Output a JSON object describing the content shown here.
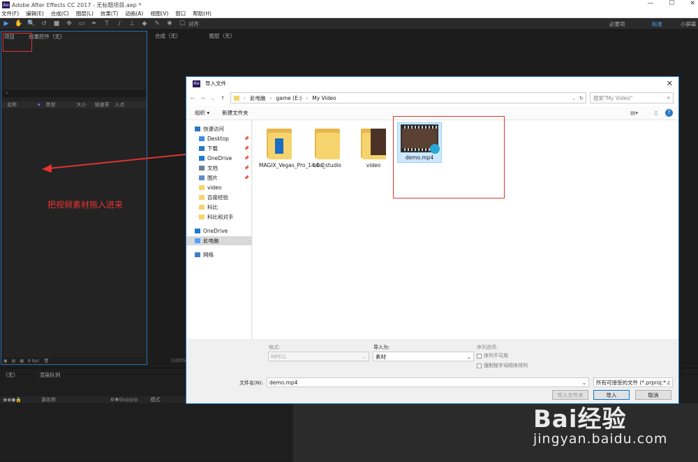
{
  "app": {
    "title": "Adobe After Effects CC 2017 - 无标题项目.aep *",
    "logo": "Ae"
  },
  "menu": [
    "文件(F)",
    "编辑(E)",
    "合成(C)",
    "图层(L)",
    "效果(T)",
    "动画(A)",
    "视图(V)",
    "窗口",
    "帮助(H)"
  ],
  "toolbar": {
    "snap_label": "对齐",
    "workspaces": [
      "必要项",
      "标准",
      "小屏幕"
    ]
  },
  "project_panel": {
    "tab": "项目",
    "effect_tab": "效果控件（无）",
    "columns": [
      "名称",
      "类型",
      "大小",
      "帧速率",
      "入点"
    ],
    "footer": "8 bpc"
  },
  "comp_panel": {
    "tab": "合成（无）",
    "layer_tab": "图层（无）",
    "zoom": "(100%)"
  },
  "timeline": {
    "tab": "（无）",
    "render_tab": "渲染队列",
    "columns": [
      "源名称",
      "模式"
    ]
  },
  "annotation": "把视频素材拖入进来",
  "dialog": {
    "title": "导入文件",
    "path": [
      "此电脑",
      "game (E:)",
      "My Video"
    ],
    "search_placeholder": "搜索\"My Video\"",
    "organize": "组织 ▾",
    "new_folder": "新建文件夹",
    "nav": [
      {
        "label": "快速访问",
        "icon": "star-icon"
      },
      {
        "label": "Desktop",
        "icon": "desktop-icon",
        "pin": true
      },
      {
        "label": "下载",
        "icon": "download-icon",
        "pin": true
      },
      {
        "label": "OneDrive",
        "icon": "cloud-icon",
        "pin": true
      },
      {
        "label": "文档",
        "icon": "document-icon",
        "pin": true
      },
      {
        "label": "图片",
        "icon": "picture-icon",
        "pin": true
      },
      {
        "label": "video",
        "icon": "folder-icon"
      },
      {
        "label": "百度经验",
        "icon": "folder-icon"
      },
      {
        "label": "科比",
        "icon": "folder-icon"
      },
      {
        "label": "科比和对手",
        "icon": "folder-icon"
      },
      {
        "label": "OneDrive",
        "icon": "cloud-icon"
      },
      {
        "label": "此电脑",
        "icon": "computer-icon",
        "selected": true
      },
      {
        "label": "网络",
        "icon": "network-icon"
      }
    ],
    "files": [
      {
        "name": "MAGIX_Vegas_Pro_14.0.0",
        "type": "folder"
      },
      {
        "name": "obs_studio",
        "type": "folder"
      },
      {
        "name": "video",
        "type": "folder"
      },
      {
        "name": "demo.mp4",
        "type": "video",
        "selected": true
      }
    ],
    "format_label": "格式:",
    "format_value": "MPEG",
    "import_as_label": "导入为:",
    "import_as_value": "素材",
    "sequence_label": "序列选项:",
    "sequence_unavailable": "序列不可用",
    "alpha_sort": "强制按字母顺序排列",
    "filename_label": "文件名(N):",
    "filename_value": "demo.mp4",
    "filetype": "所有可接受的文件 (*.prproj;*.c",
    "import_folder_btn": "导入文件夹",
    "import_btn": "导入",
    "cancel_btn": "取消"
  },
  "watermark": {
    "brand": "Bai经验",
    "url": "jingyan.baidu.com"
  },
  "colors": {
    "annotation_red": "#e33333",
    "accent_blue": "#1979ca"
  }
}
